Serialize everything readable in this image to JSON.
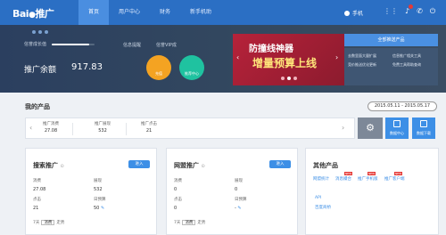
{
  "header": {
    "logo_text": "Bai",
    "logo_sub": "推广",
    "tabs": [
      {
        "label": "首页",
        "active": true
      },
      {
        "label": "用户中心",
        "active": false
      },
      {
        "label": "财务",
        "active": false
      },
      {
        "label": "新手机助",
        "active": false
      }
    ],
    "username": "手机",
    "accent_color": "#2b6fc4"
  },
  "hero": {
    "growth_label": "信誉成长值",
    "growth_progress": 0.88,
    "link_message": "信息提醒",
    "link_vip": "信誉VIP成",
    "balance_label": "推广余额",
    "balance_value": "917.83",
    "btn_charge": "充值",
    "btn_help": "推荐中心"
  },
  "banner": {
    "line1": "防撞线神器",
    "line2": "增量预算上线",
    "pages": 3,
    "active_page": 1
  },
  "promo": {
    "button_label": "全部推送产品",
    "items": [
      "去数里面大量扩展",
      "信息推广相关工具",
      "竞价推送优化更新",
      "免费工具帮助查询"
    ]
  },
  "products": {
    "title": "我的产品",
    "date_range": "2015.05.11 - 2015.05.17",
    "stats": [
      {
        "label": "推广消费",
        "value": "27.08"
      },
      {
        "label": "推广展现",
        "value": "532"
      },
      {
        "label": "推广点击",
        "value": "21"
      }
    ],
    "tile_a": "数据中心",
    "tile_b": "数据下载"
  },
  "search_card": {
    "title": "搜索推广",
    "cta": "进入",
    "metrics": [
      {
        "label": "消费",
        "value": "27.08"
      },
      {
        "label": "展现",
        "value": "532"
      },
      {
        "label": "点击",
        "value": "21"
      },
      {
        "label": "日预算",
        "value": "50"
      }
    ],
    "foot_prefix": "7天",
    "foot_select": "消费",
    "foot_suffix": "走势"
  },
  "network_card": {
    "title": "网盟推广",
    "cta": "进入",
    "metrics": [
      {
        "label": "消费",
        "value": "0"
      },
      {
        "label": "展现",
        "value": "0"
      },
      {
        "label": "点击",
        "value": "0"
      },
      {
        "label": "日预算",
        "value": "-"
      }
    ],
    "foot_prefix": "7天",
    "foot_select": "消费",
    "foot_suffix": "走势"
  },
  "other_card": {
    "title": "其他产品",
    "links": [
      "网盟统计",
      "消息撮合",
      "推广手机版",
      "推广客户端",
      "API",
      "百度商桥"
    ],
    "new_badge": "NEW"
  }
}
